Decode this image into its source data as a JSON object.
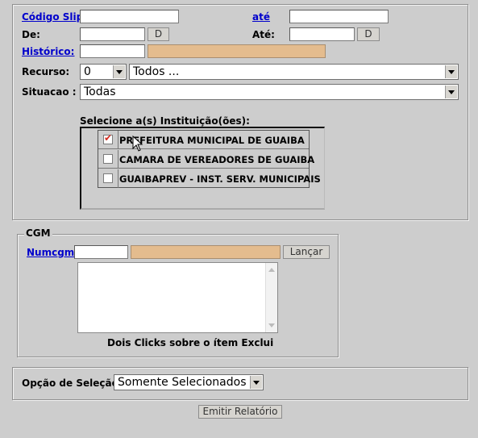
{
  "filters": {
    "codigo_slip_label": "Código Slip:",
    "ate_link_label": "até",
    "de_label": "De:",
    "ate_label": "Até:",
    "date_button": "D",
    "historico_label": "Histórico:",
    "recurso_label": "Recurso:",
    "recurso_code": "0",
    "recurso_value": "Todos ...",
    "situacao_label": "Situacao :",
    "situacao_value": "Todas"
  },
  "instituicoes": {
    "title": "Selecione a(s) Instituição(ões):",
    "items": [
      {
        "label": "PREFEITURA MUNICIPAL DE GUAIBA",
        "checked": true
      },
      {
        "label": "CAMARA DE VEREADORES DE GUAIBA",
        "checked": false
      },
      {
        "label": "GUAIBAPREV - INST. SERV. MUNICIPAIS",
        "checked": false
      }
    ]
  },
  "cgm": {
    "legend": "CGM",
    "numcgm_label": "Numcgm:",
    "lancar_button": "Lançar",
    "hint": "Dois Clicks sobre o ítem Exclui"
  },
  "opcao": {
    "label": "Opção de Seleção :",
    "value": "Somente Selecionados"
  },
  "emitir_button": "Emitir Relatório"
}
